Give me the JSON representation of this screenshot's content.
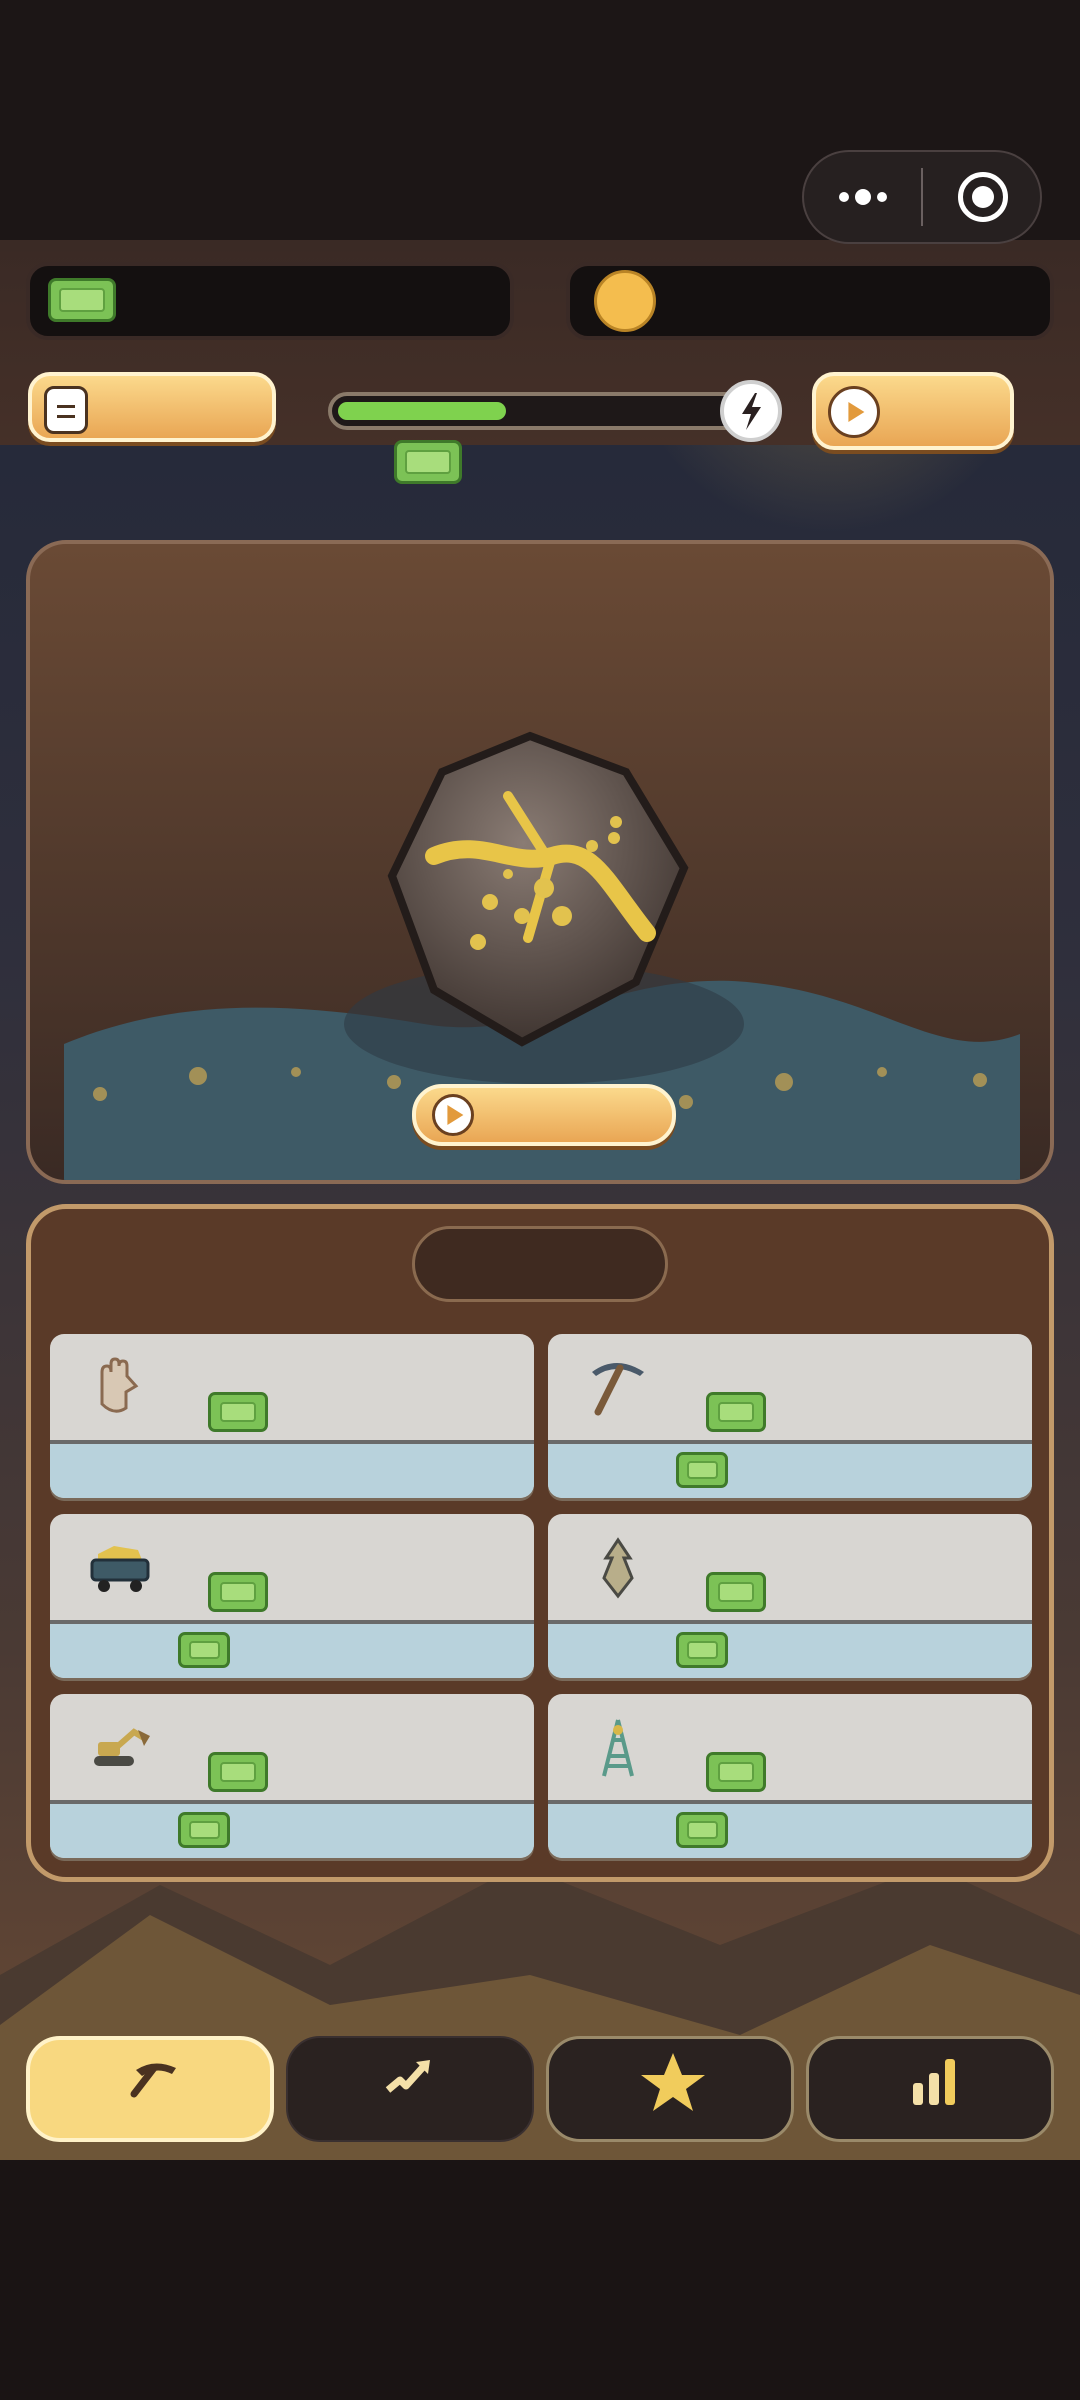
{
  "capsule": {
    "more_icon": "more-dots-icon",
    "close_icon": "target-circle-icon"
  },
  "hud": {
    "cash_icon": "cash-icon",
    "coin_icon": "gold-coin-icon",
    "list_icon": "list-icon",
    "play_icon": "play-icon",
    "energy_icon": "lightning-icon",
    "progress": 0.42
  },
  "mine": {
    "rock": "gold-ore-rock",
    "play_icon": "play-icon"
  },
  "shop": {
    "items": [
      {
        "icon": "glove-hand-icon",
        "has_bottom_cash": false
      },
      {
        "icon": "pickaxe-icon",
        "has_bottom_cash": true
      },
      {
        "icon": "mine-cart-icon",
        "has_bottom_cash": true
      },
      {
        "icon": "drill-bit-icon",
        "has_bottom_cash": true
      },
      {
        "icon": "excavator-icon",
        "has_bottom_cash": true
      },
      {
        "icon": "drilling-tower-icon",
        "has_bottom_cash": true
      }
    ]
  },
  "nav": {
    "items": [
      {
        "icon": "pickaxe-icon",
        "active": true
      },
      {
        "icon": "upgrade-arrow-icon",
        "active": false
      },
      {
        "icon": "star-icon",
        "active": false
      },
      {
        "icon": "leaderboard-bars-icon",
        "active": false
      }
    ]
  },
  "colors": {
    "accent": "#f1b75c",
    "cash_green": "#7cc256",
    "panel_brown": "#5a3a28",
    "nav_active": "#f8d880"
  }
}
